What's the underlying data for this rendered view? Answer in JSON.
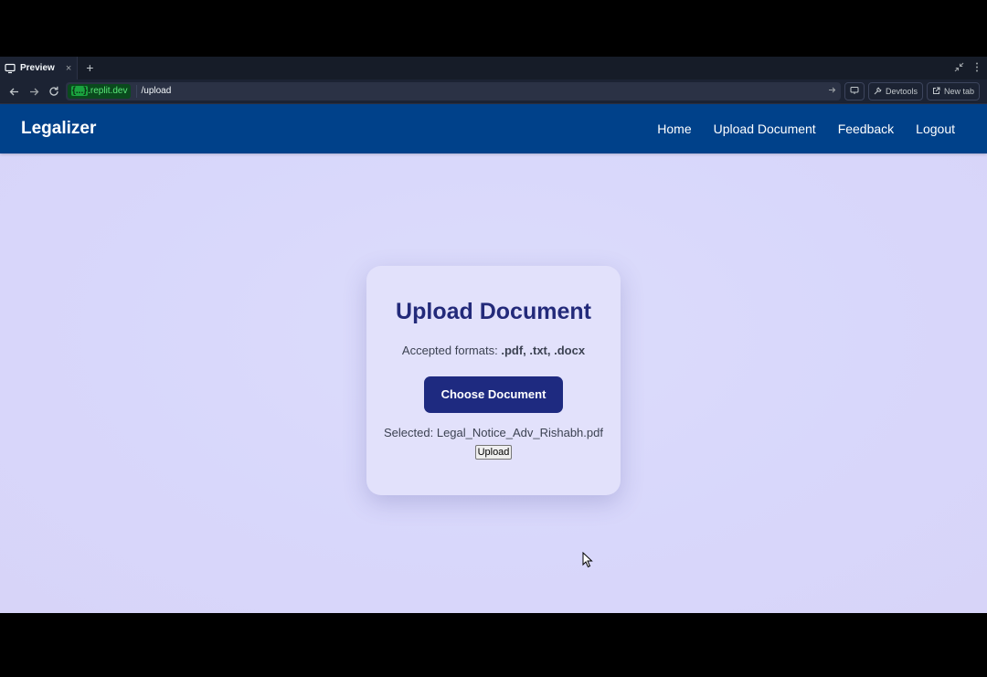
{
  "browser": {
    "tab_title": "Preview",
    "tab_close": "×",
    "new_tab": "+",
    "domain_braces": "{...}",
    "domain_rest": ".replit.dev",
    "path": "/upload",
    "devtools_label": "Devtools",
    "new_tab_label": "New tab"
  },
  "navbar": {
    "brand": "Legalizer",
    "links": [
      "Home",
      "Upload Document",
      "Feedback",
      "Logout"
    ]
  },
  "card": {
    "title": "Upload Document",
    "formats_label": "Accepted formats:",
    "formats_value": ".pdf, .txt, .docx",
    "choose_button": "Choose Document",
    "selected_label": "Selected:",
    "selected_file": "Legal_Notice_Adv_Rishabh.pdf",
    "upload_button": "Upload"
  },
  "colors": {
    "navbar_bg": "#00418a",
    "page_bg": "#d8d7fb",
    "card_bg": "#e2e1fb",
    "title": "#232a7a",
    "primary_button": "#1e2a80",
    "domain_text": "#5bea7b"
  }
}
